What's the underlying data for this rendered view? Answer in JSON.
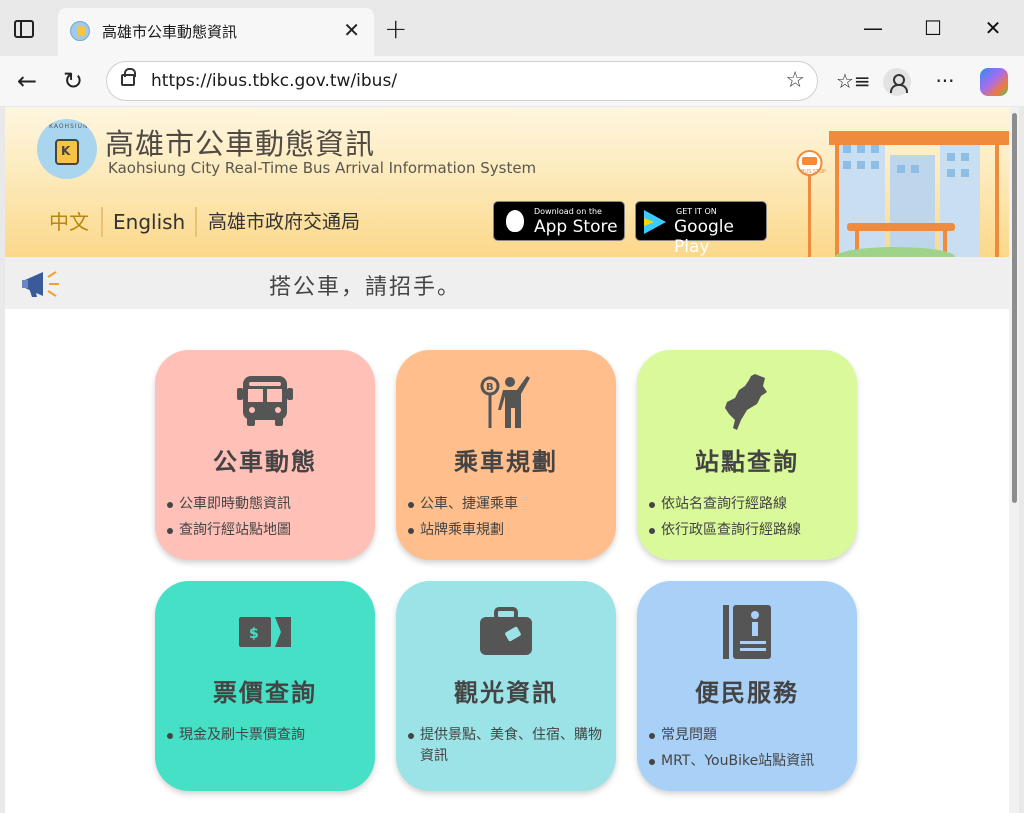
{
  "browser": {
    "tab_title": "高雄市公車動態資訊",
    "url": "https://ibus.tbkc.gov.tw/ibus/"
  },
  "header": {
    "title": "高雄市公車動態資訊",
    "subtitle": "Kaohsiung City Real-Time Bus Arrival Information System",
    "logo_text": "KAOHSIUNG",
    "logo_letter": "K",
    "lang_zh": "中文",
    "lang_en": "English",
    "agency": "高雄市政府交通局",
    "app_store_small": "Download on the",
    "app_store_big": "App Store",
    "google_play_small": "GET IT ON",
    "google_play_big": "Google Play",
    "bus_stop_sign": "BUS STOP"
  },
  "notice": {
    "text": "搭公車，請招手。"
  },
  "cards": [
    {
      "title": "公車動態",
      "icon": "bus-icon",
      "color": "#ffc0b8",
      "items": [
        "公車即時動態資訊",
        "查詢行經站點地圖"
      ]
    },
    {
      "title": "乘車規劃",
      "icon": "passenger-at-stop-icon",
      "color": "#ffbe8c",
      "items": [
        "公車、捷運乘車",
        "站牌乘車規劃"
      ]
    },
    {
      "title": "站點查詢",
      "icon": "taiwan-map-icon",
      "color": "#daf99a",
      "items": [
        "依站名查詢行經路線",
        "依行政區查詢行經路線"
      ]
    },
    {
      "title": "票價查詢",
      "icon": "ticket-icon",
      "color": "#46e0c6",
      "items": [
        "現金及刷卡票價查詢"
      ]
    },
    {
      "title": "觀光資訊",
      "icon": "suitcase-icon",
      "color": "#9be3e6",
      "items": [
        "提供景點、美食、住宿、購物資訊"
      ]
    },
    {
      "title": "便民服務",
      "icon": "info-book-icon",
      "color": "#a9d1f8",
      "items": [
        "常見問題",
        "MRT、YouBike站點資訊"
      ]
    }
  ]
}
